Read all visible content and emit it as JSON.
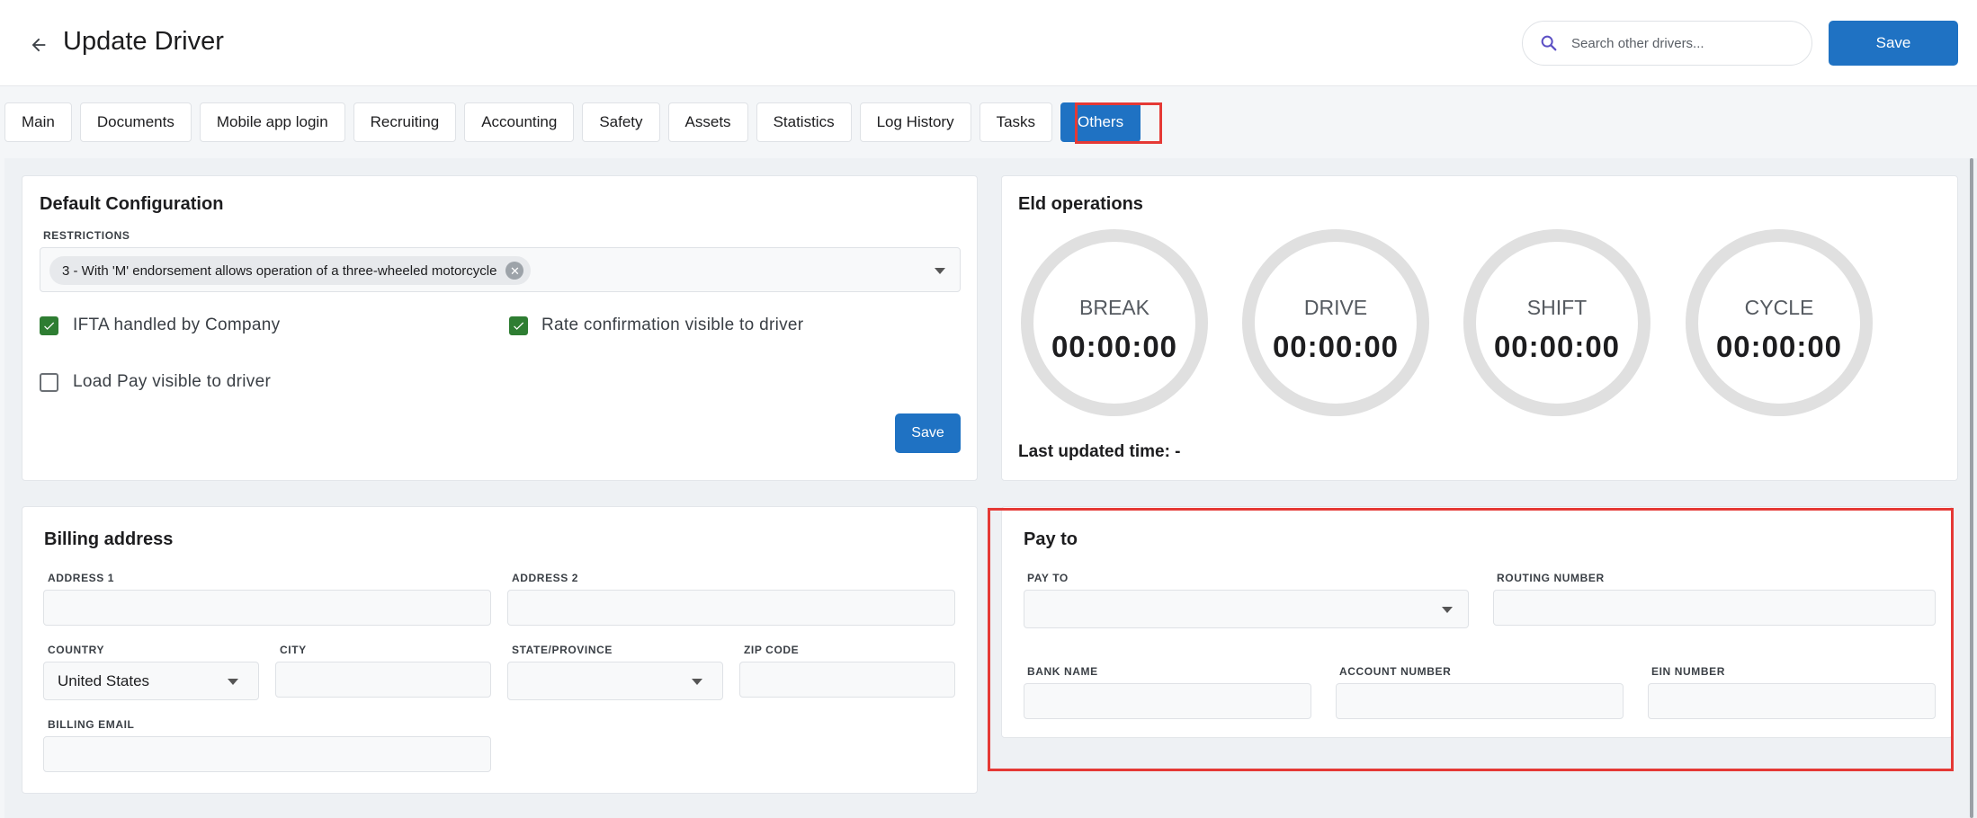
{
  "header": {
    "title": "Update Driver",
    "search_placeholder": "Search other drivers...",
    "save_label": "Save"
  },
  "tabs": [
    {
      "label": "Main"
    },
    {
      "label": "Documents"
    },
    {
      "label": "Mobile app login"
    },
    {
      "label": "Recruiting"
    },
    {
      "label": "Accounting"
    },
    {
      "label": "Safety"
    },
    {
      "label": "Assets"
    },
    {
      "label": "Statistics"
    },
    {
      "label": "Log History"
    },
    {
      "label": "Tasks"
    },
    {
      "label": "Others",
      "active": true
    }
  ],
  "default_config": {
    "title": "Default Configuration",
    "restrictions_label": "RESTRICTIONS",
    "restriction_chip": "3 - With 'M' endorsement allows operation of a three-wheeled motorcycle",
    "ifta_label": "IFTA handled by Company",
    "ifta_checked": true,
    "rate_conf_label": "Rate confirmation visible to driver",
    "rate_conf_checked": true,
    "load_pay_label": "Load Pay visible to driver",
    "load_pay_checked": false,
    "save_label": "Save"
  },
  "eld": {
    "title": "Eld operations",
    "gauges": [
      {
        "label": "BREAK",
        "value": "00:00:00"
      },
      {
        "label": "DRIVE",
        "value": "00:00:00"
      },
      {
        "label": "SHIFT",
        "value": "00:00:00"
      },
      {
        "label": "CYCLE",
        "value": "00:00:00"
      }
    ],
    "last_updated": "Last updated time: -"
  },
  "billing": {
    "title": "Billing address",
    "address1_label": "ADDRESS 1",
    "address1_value": "",
    "address2_label": "ADDRESS 2",
    "address2_value": "",
    "country_label": "COUNTRY",
    "country_value": "United States",
    "city_label": "CITY",
    "city_value": "",
    "state_label": "STATE/PROVINCE",
    "state_value": "",
    "zip_label": "ZIP CODE",
    "zip_value": "",
    "email_label": "BILLING EMAIL",
    "email_value": ""
  },
  "pay_to": {
    "title": "Pay to",
    "pay_to_label": "PAY TO",
    "pay_to_value": "",
    "routing_label": "ROUTING NUMBER",
    "routing_value": "",
    "bank_label": "BANK NAME",
    "bank_value": "",
    "account_label": "ACCOUNT NUMBER",
    "account_value": "",
    "ein_label": "EIN NUMBER",
    "ein_value": ""
  },
  "colors": {
    "primary": "#1f72c3",
    "checkbox_checked": "#2e7d32",
    "highlight": "#e53935",
    "gauge_ring": "#e0e0e0"
  },
  "icons": {
    "back": "arrow-left-icon",
    "search": "search-icon",
    "chip_remove": "close-circle-icon",
    "dropdown": "caret-down-icon",
    "check": "checkmark-icon"
  }
}
